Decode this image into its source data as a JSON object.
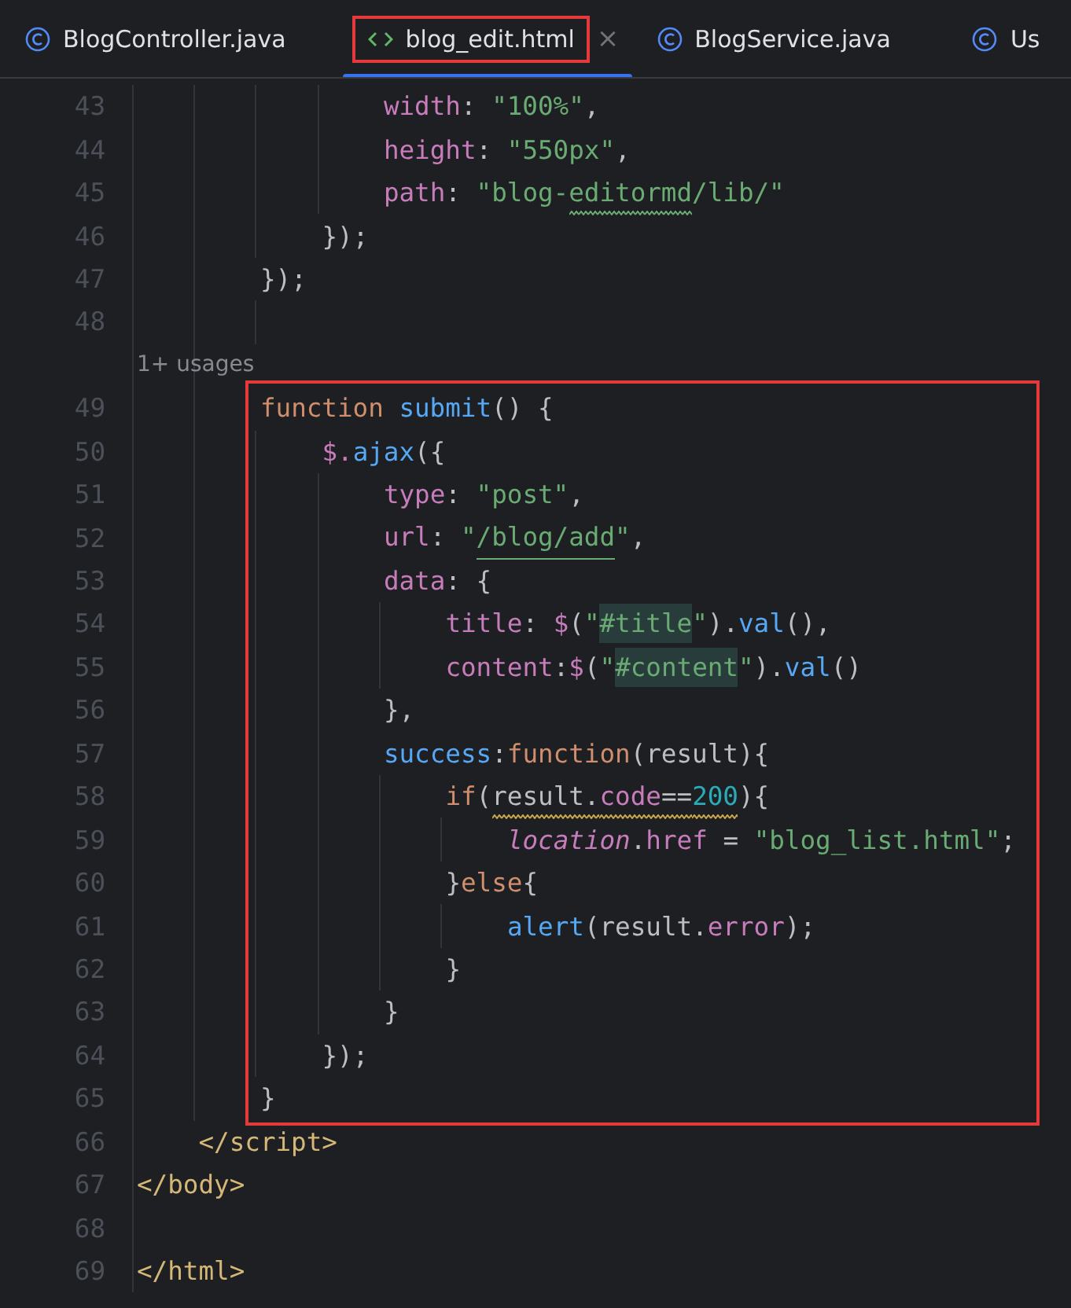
{
  "tabs": [
    {
      "label": "BlogController.java",
      "kind": "class",
      "selected": false,
      "annotated": false
    },
    {
      "label": "blog_edit.html",
      "kind": "html",
      "selected": true,
      "close": "×",
      "annotated": true
    },
    {
      "label": "BlogService.java",
      "kind": "class",
      "selected": false,
      "annotated": false
    },
    {
      "label": "Us",
      "kind": "class",
      "selected": false,
      "annotated": false
    }
  ],
  "editor": {
    "lines_before": [
      {
        "number": "43",
        "tokens": [
          {
            "text": "                width",
            "kind": "prop"
          },
          {
            "text": ": ",
            "kind": "plain"
          },
          {
            "text": "\"100%\"",
            "kind": "string"
          },
          {
            "text": ",",
            "kind": "plain"
          }
        ]
      },
      {
        "number": "44",
        "tokens": [
          {
            "text": "                height",
            "kind": "prop"
          },
          {
            "text": ": ",
            "kind": "plain"
          },
          {
            "text": "\"550px\"",
            "kind": "string"
          },
          {
            "text": ",",
            "kind": "plain"
          }
        ]
      },
      {
        "number": "45",
        "tokens": [
          {
            "text": "                path",
            "kind": "prop"
          },
          {
            "text": ": ",
            "kind": "plain"
          },
          {
            "text": "\"blog-",
            "kind": "string"
          },
          {
            "text": "editormd",
            "kind": "string",
            "spelling_warning": true
          },
          {
            "text": "/lib/\"",
            "kind": "string"
          }
        ]
      },
      {
        "number": "46",
        "tokens": [
          {
            "text": "            });",
            "kind": "plain"
          }
        ]
      },
      {
        "number": "47",
        "tokens": [
          {
            "text": "        });",
            "kind": "plain"
          }
        ]
      },
      {
        "number": "48"
      },
      {
        "hint": "        1+ usages"
      }
    ],
    "boxed_lines": [
      {
        "number": "49",
        "tokens": [
          {
            "text": "        function ",
            "kind": "keyword"
          },
          {
            "text": "submit",
            "kind": "func"
          },
          {
            "text": "() {",
            "kind": "plain"
          }
        ]
      },
      {
        "number": "50",
        "tokens": [
          {
            "text": "            $.",
            "kind": "prop"
          },
          {
            "text": "ajax",
            "kind": "func"
          },
          {
            "text": "({",
            "kind": "plain"
          }
        ]
      },
      {
        "number": "51",
        "tokens": [
          {
            "text": "                type",
            "kind": "prop"
          },
          {
            "text": ": ",
            "kind": "plain"
          },
          {
            "text": "\"post\"",
            "kind": "string"
          },
          {
            "text": ",",
            "kind": "plain"
          }
        ]
      },
      {
        "number": "52",
        "tokens": [
          {
            "text": "                url",
            "kind": "prop"
          },
          {
            "text": ": ",
            "kind": "plain"
          },
          {
            "text": "\"",
            "kind": "string"
          },
          {
            "text": "/blog/add",
            "kind": "string",
            "link": true
          },
          {
            "text": "\"",
            "kind": "string"
          },
          {
            "text": ",",
            "kind": "plain"
          }
        ]
      },
      {
        "number": "53",
        "tokens": [
          {
            "text": "                data",
            "kind": "prop"
          },
          {
            "text": ": {",
            "kind": "plain"
          }
        ]
      },
      {
        "number": "54",
        "tokens": [
          {
            "text": "                    title",
            "kind": "prop"
          },
          {
            "text": ": ",
            "kind": "plain"
          },
          {
            "text": "$",
            "kind": "prop"
          },
          {
            "text": "(",
            "kind": "plain"
          },
          {
            "text": "\"",
            "kind": "string"
          },
          {
            "text": "#title",
            "kind": "string",
            "search_match": true
          },
          {
            "text": "\"",
            "kind": "string"
          },
          {
            "text": ").",
            "kind": "plain"
          },
          {
            "text": "val",
            "kind": "func"
          },
          {
            "text": "(),",
            "kind": "plain"
          }
        ]
      },
      {
        "number": "55",
        "tokens": [
          {
            "text": "                    content",
            "kind": "prop"
          },
          {
            "text": ":",
            "kind": "plain"
          },
          {
            "text": "$",
            "kind": "prop"
          },
          {
            "text": "(",
            "kind": "plain"
          },
          {
            "text": "\"",
            "kind": "string"
          },
          {
            "text": "#content",
            "kind": "string",
            "search_match": true
          },
          {
            "text": "\"",
            "kind": "string"
          },
          {
            "text": ").",
            "kind": "plain"
          },
          {
            "text": "val",
            "kind": "func"
          },
          {
            "text": "()",
            "kind": "plain"
          }
        ]
      },
      {
        "number": "56",
        "tokens": [
          {
            "text": "                },",
            "kind": "plain"
          }
        ]
      },
      {
        "number": "57",
        "tokens": [
          {
            "text": "                success",
            "kind": "func"
          },
          {
            "text": ":",
            "kind": "plain"
          },
          {
            "text": "function",
            "kind": "keyword"
          },
          {
            "text": "(result){",
            "kind": "plain"
          }
        ]
      },
      {
        "number": "58",
        "tokens": [
          {
            "text": "                    if",
            "kind": "keyword"
          },
          {
            "text": "(",
            "kind": "plain"
          },
          {
            "text": "result.",
            "kind": "plain",
            "code_warning": true
          },
          {
            "text": "code",
            "kind": "prop",
            "code_warning": true
          },
          {
            "text": "==",
            "kind": "plain",
            "code_warning": true
          },
          {
            "text": "200",
            "kind": "number",
            "code_warning": true
          },
          {
            "text": "){",
            "kind": "plain"
          }
        ]
      },
      {
        "number": "59",
        "tokens": [
          {
            "text": "                        location",
            "kind": "global"
          },
          {
            "text": ".",
            "kind": "plain"
          },
          {
            "text": "href",
            "kind": "prop"
          },
          {
            "text": " = ",
            "kind": "plain"
          },
          {
            "text": "\"blog_list.html\"",
            "kind": "string"
          },
          {
            "text": ";",
            "kind": "plain"
          }
        ]
      },
      {
        "number": "60",
        "tokens": [
          {
            "text": "                    }",
            "kind": "plain"
          },
          {
            "text": "else",
            "kind": "keyword"
          },
          {
            "text": "{",
            "kind": "plain"
          }
        ]
      },
      {
        "number": "61",
        "tokens": [
          {
            "text": "                        alert",
            "kind": "func"
          },
          {
            "text": "(result.",
            "kind": "plain"
          },
          {
            "text": "error",
            "kind": "prop"
          },
          {
            "text": ");",
            "kind": "plain"
          }
        ]
      },
      {
        "number": "62",
        "tokens": [
          {
            "text": "                    }",
            "kind": "plain"
          }
        ]
      },
      {
        "number": "63",
        "tokens": [
          {
            "text": "                }",
            "kind": "plain"
          }
        ]
      },
      {
        "number": "64",
        "tokens": [
          {
            "text": "            });",
            "kind": "plain"
          }
        ]
      },
      {
        "number": "65",
        "tokens": [
          {
            "text": "        }",
            "kind": "plain"
          }
        ]
      }
    ],
    "lines_after": [
      {
        "number": "66",
        "tokens": [
          {
            "text": "    </script>",
            "kind": "tag"
          }
        ]
      },
      {
        "number": "67",
        "tokens": [
          {
            "text": "</body>",
            "kind": "tag"
          }
        ]
      },
      {
        "number": "68"
      },
      {
        "number": "69",
        "tokens": [
          {
            "text": "</html>",
            "kind": "tag"
          }
        ]
      }
    ]
  }
}
